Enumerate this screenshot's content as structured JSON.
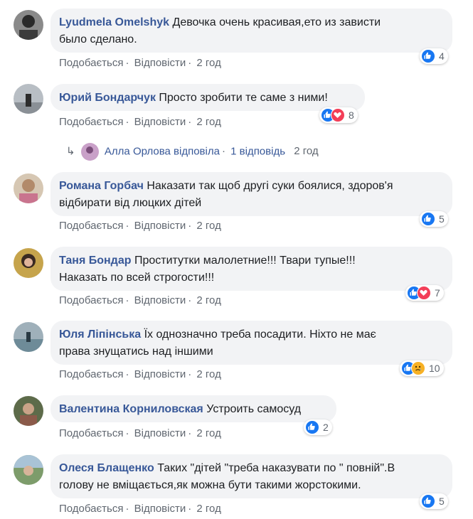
{
  "actions": {
    "like": "Подобається",
    "reply": "Відповісти"
  },
  "comments": [
    {
      "author": "Lyudmela Omelshyk",
      "text1": "Девочка очень красивая,ето из зависти",
      "text2": "было сделано.",
      "time": "2 год",
      "reactions": [
        "like"
      ],
      "count": "4"
    },
    {
      "author": "Юрий Бондарчук",
      "text1": "Просто зробити те саме з ними!",
      "text2": "",
      "time": "2 год",
      "reactions": [
        "like",
        "love"
      ],
      "count": "8"
    },
    {
      "author": "Романа Горбач",
      "text1": "Наказати так щоб другі суки боялися, здоров'я",
      "text2": "відбирати від люцких дітей",
      "time": "2 год",
      "reactions": [
        "like"
      ],
      "count": "5"
    },
    {
      "author": "Таня Бондар",
      "text1": "Проститутки малолетние!!! Твари тупые!!!",
      "text2": "Наказать по всей строгости!!!",
      "time": "2 год",
      "reactions": [
        "like",
        "love"
      ],
      "count": "7"
    },
    {
      "author": "Юля Ліпінська",
      "text1": "Їх однозначно треба посадити. Ніхто не має",
      "text2": "права знущатись над іншими",
      "time": "2 год",
      "reactions": [
        "like",
        "sad"
      ],
      "count": "10"
    },
    {
      "author": "Валентина Корниловская",
      "text1": "Устроить самосуд",
      "text2": "",
      "time": "2 год",
      "reactions": [
        "like"
      ],
      "count": "2"
    },
    {
      "author": "Олеся Блащенко",
      "text1": "Таких \"дітей \"треба наказувати по \" повній\".В",
      "text2": "голову не вміщається,як можна бути такими жорстокими.",
      "time": "2 год",
      "reactions": [
        "like"
      ],
      "count": "5"
    }
  ],
  "reply_summary": {
    "name": "Алла Орлова",
    "verb": "відповіла",
    "count_text": "1 відповідь",
    "time": "2 год"
  }
}
